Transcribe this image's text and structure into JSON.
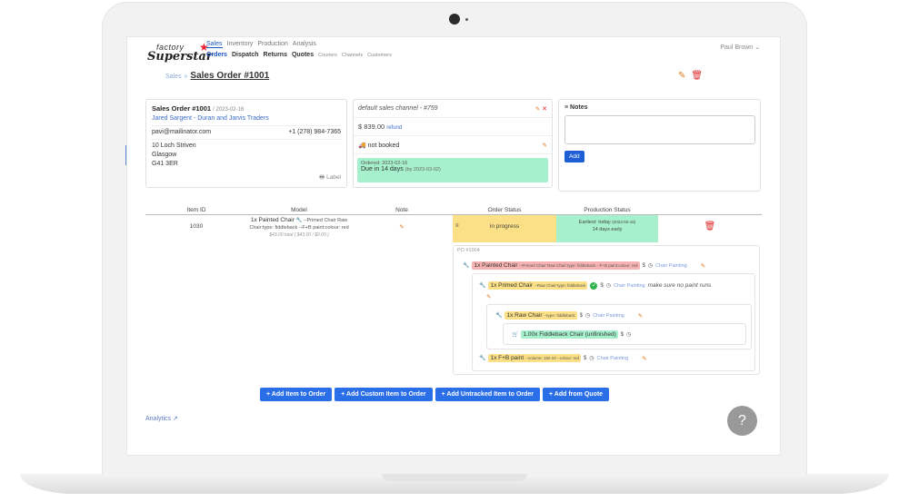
{
  "brand": {
    "line1": "factory",
    "line2": "Superstar"
  },
  "nav": {
    "primary": [
      "Sales",
      "Inventory",
      "Production",
      "Analysis"
    ],
    "secondary_main": [
      "Orders",
      "Dispatch",
      "Returns",
      "Quotes"
    ],
    "secondary_small": [
      "Couriers",
      "Channels",
      "Customers"
    ]
  },
  "user": {
    "name": "Paul Brown"
  },
  "breadcrumb": {
    "parent": "Sales",
    "sep": "»",
    "title": "Sales Order #1001"
  },
  "order": {
    "heading": "Sales Order #1001",
    "date": "/ 2023-02-16",
    "customer": "Jared Sargent - Duran and Jarvis Traders",
    "email": "pavi@mailinator.com",
    "phone": "+1 (278) 984-7365",
    "address": [
      "10 Loch Striven",
      "Glasgow",
      "G41 3ER"
    ],
    "label_link": "Label"
  },
  "channel": {
    "name": "default sales channel - #759",
    "amount": "$ 839.00",
    "refund": "refund",
    "shipping": "not booked",
    "ordered": "Ordered: 2023-02-16",
    "due": "Due in 14 days",
    "due_by": "(by 2023-03-02)"
  },
  "notes": {
    "title": "Notes",
    "add": "Add"
  },
  "table": {
    "headers": [
      "Item ID",
      "Model",
      "Note",
      "Order Status",
      "Production Status",
      ""
    ],
    "row": {
      "id": "1030",
      "model_line1": "1x Painted Chair",
      "model_line1b": "--Primed Chair Raw",
      "model_line2": "Chair:type: fiddleback --F+B paint:colour: red",
      "model_line3": "$43.00 total ( $43.00 / $0.00 )",
      "order_status": "in progress",
      "prod_line1": "Earliest: today",
      "prod_line1b": "(2023-02-16)",
      "prod_line2": "14 days early"
    }
  },
  "po": {
    "id": "PO #1004",
    "items": [
      {
        "qty": "1x Painted Chair",
        "detail": "--Primed Chair Raw Chair:type: fiddleback --F+B paint:colour: red",
        "link": "Chair Painting",
        "note": ""
      },
      {
        "qty": "1x Primed Chair",
        "detail": "--Raw Chair:type: fiddleback",
        "link": "Chair Painting",
        "note": "make sure no paint runs"
      },
      {
        "qty": "1x Raw Chair",
        "detail": "--type: fiddleback",
        "link": "Chair Painting",
        "note": ""
      },
      {
        "qty": "1.00x Fiddleback Chair (unfinished)",
        "detail": "",
        "link": "",
        "note": ""
      },
      {
        "qty": "1x F+B paint",
        "detail": "--volume: 150 ml --colour: red",
        "link": "Chair Painting",
        "note": ""
      }
    ]
  },
  "actions": [
    "+ Add Item to Order",
    "+ Add Custom Item to Order",
    "+ Add Untracked Item to Order",
    "+ Add from Quote"
  ],
  "footer": {
    "analytics": "Analytics",
    "help": "?"
  },
  "colors": {
    "primary": "#2a6ee8",
    "yellow": "#fbe087",
    "green": "#a6f0cd",
    "pink": "#f7b3b3",
    "danger": "#e02b2b"
  }
}
